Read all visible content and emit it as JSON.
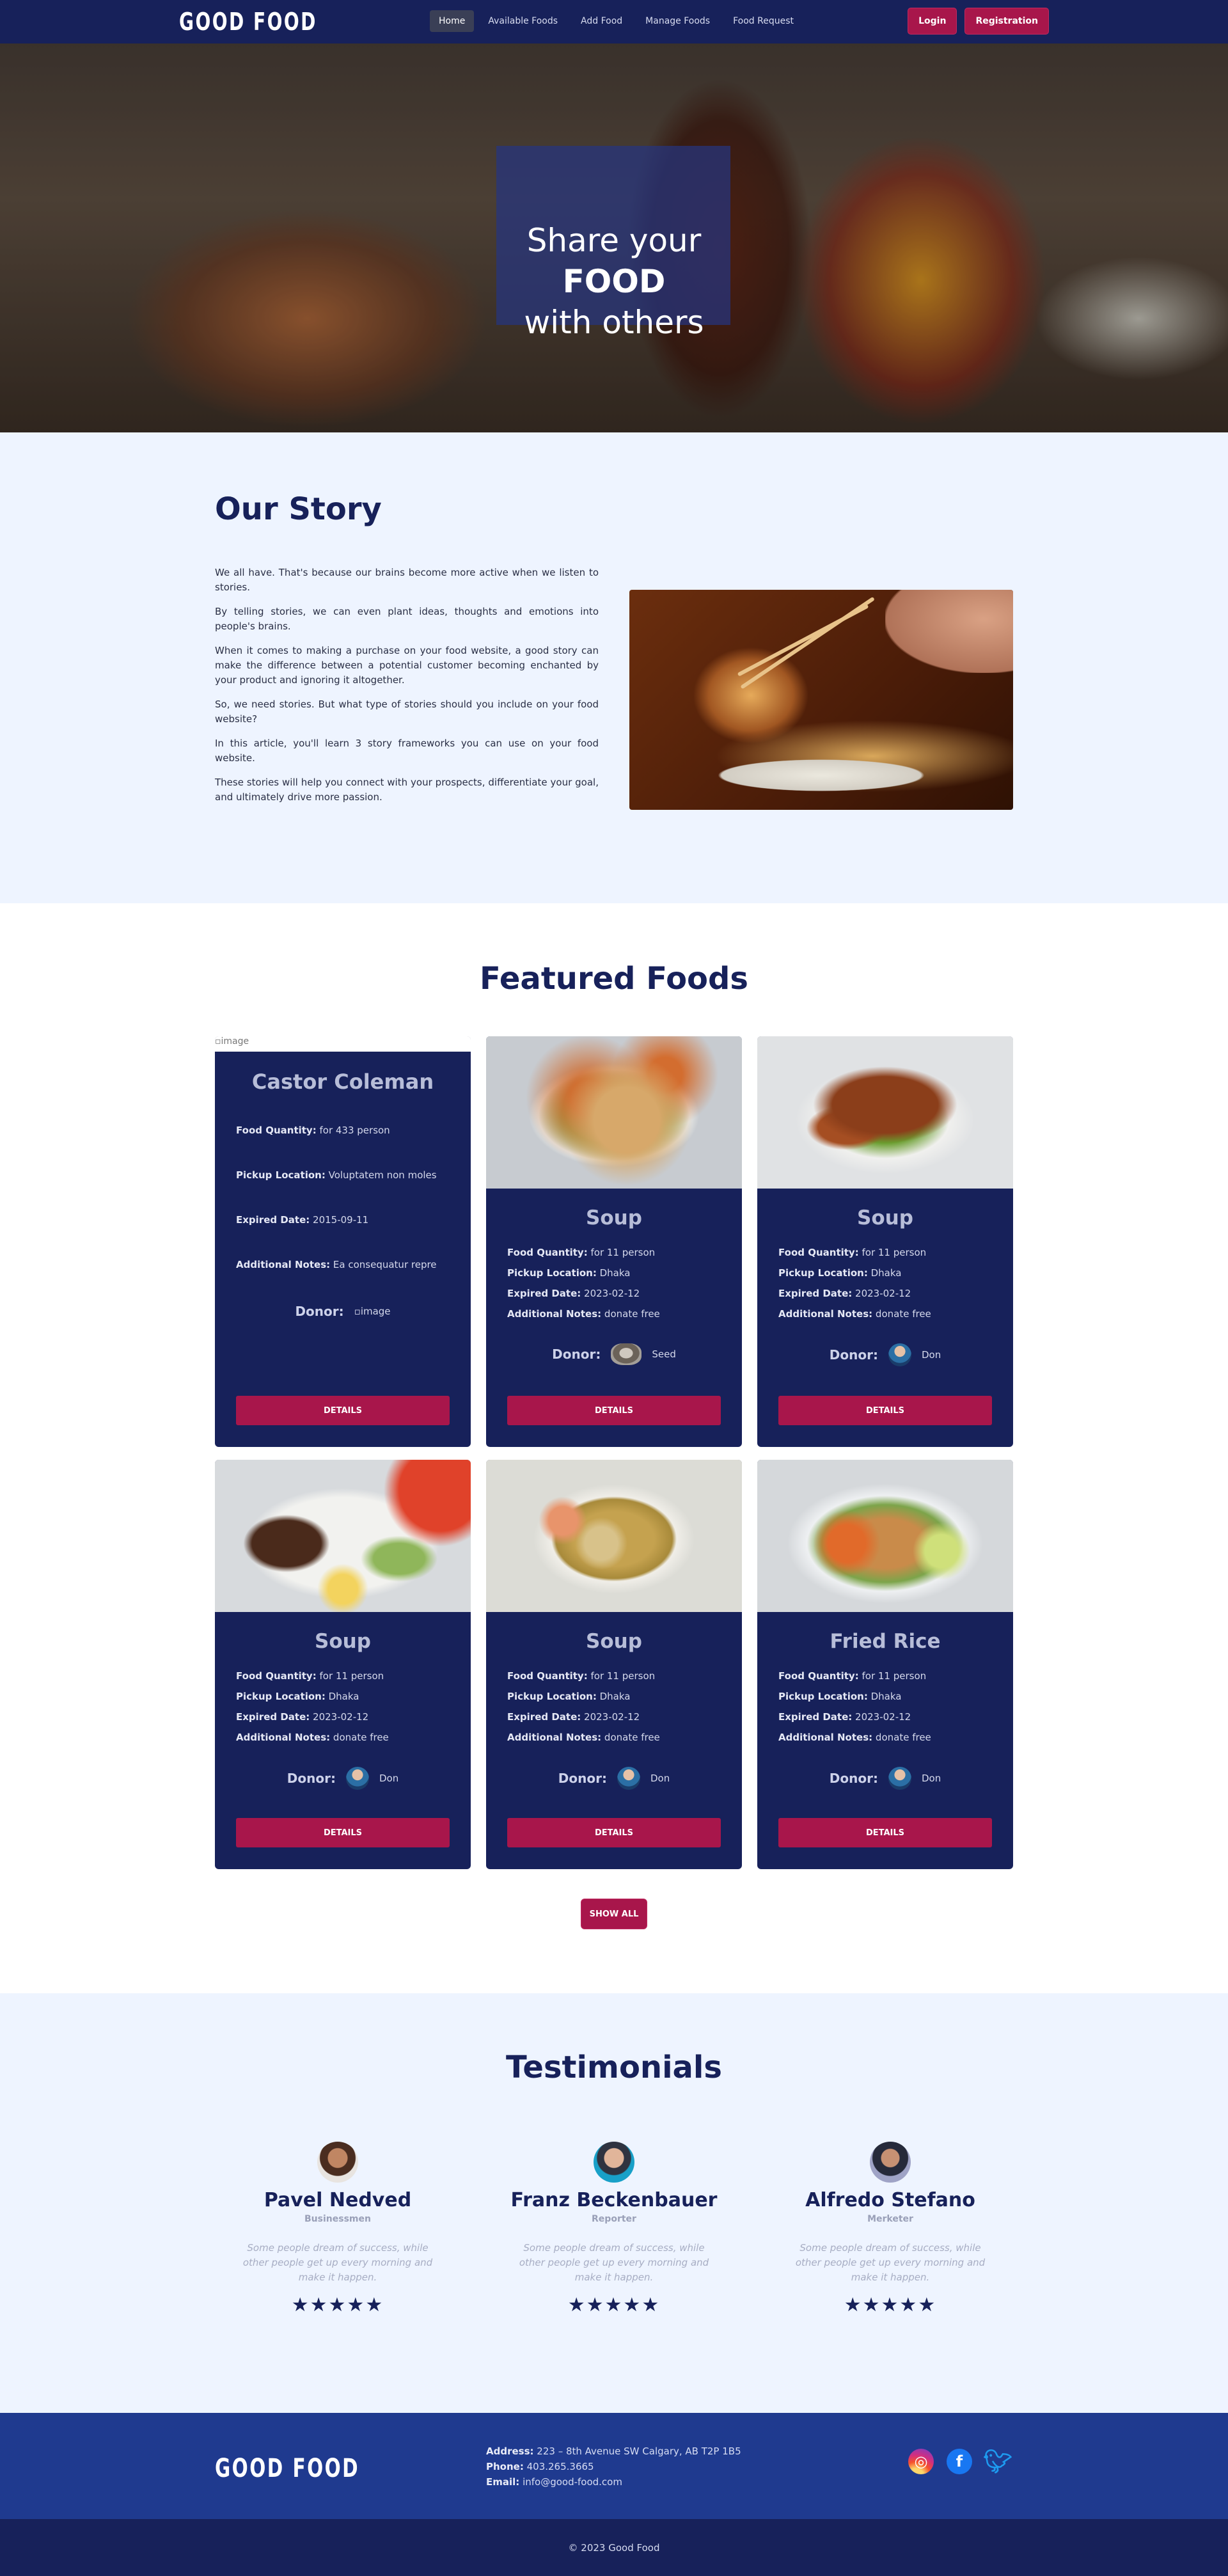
{
  "nav": {
    "logo": "GOOD FOOD",
    "links": [
      "Home",
      "Available Foods",
      "Add Food",
      "Manage Foods",
      "Food Request"
    ],
    "login": "Login",
    "registration": "Registration"
  },
  "hero": {
    "line1": "Share your",
    "line2": "FOOD",
    "line3": "with others"
  },
  "story": {
    "title": "Our Story",
    "paragraphs": [
      "We all have. That's because our brains become more active when we listen to stories.",
      "By telling stories, we can even plant ideas, thoughts and emotions into people's brains.",
      "When it comes to making a purchase on your food website, a good story can make the difference between a potential customer becoming enchanted by your product and ignoring it altogether.",
      "So, we need stories. But what type of stories should you include on your food website?",
      "In this article, you'll learn 3 story frameworks you can use on your food website.",
      "These stories will help you connect with your prospects, differentiate your goal, and ultimately drive more passion."
    ]
  },
  "featured": {
    "title": "Featured Foods",
    "labels": {
      "qty": "Food Quantity:",
      "pickup": "Pickup Location:",
      "expired": "Expired Date:",
      "notes": "Additional Notes:",
      "donor": "Donor:",
      "details": "DETAILS",
      "image_alt": "image"
    },
    "cards": [
      {
        "name": "Castor Coleman",
        "qty": "for 433 person",
        "pickup": "Voluptatem non moles",
        "expired": "2015-09-11",
        "notes": "Ea consequatur repre",
        "donor": ""
      },
      {
        "name": "Soup",
        "qty": "for 11 person",
        "pickup": "Dhaka",
        "expired": "2023-02-12",
        "notes": "donate free",
        "donor": "Seed"
      },
      {
        "name": "Soup",
        "qty": "for 11 person",
        "pickup": "Dhaka",
        "expired": "2023-02-12",
        "notes": "donate free",
        "donor": "Don"
      },
      {
        "name": "Soup",
        "qty": "for 11 person",
        "pickup": "Dhaka",
        "expired": "2023-02-12",
        "notes": "donate free",
        "donor": "Don"
      },
      {
        "name": "Soup",
        "qty": "for 11 person",
        "pickup": "Dhaka",
        "expired": "2023-02-12",
        "notes": "donate free",
        "donor": "Don"
      },
      {
        "name": "Fried Rice",
        "qty": "for 11 person",
        "pickup": "Dhaka",
        "expired": "2023-02-12",
        "notes": "donate free",
        "donor": "Don"
      }
    ],
    "show_all": "SHOW ALL"
  },
  "testimonials": {
    "title": "Testimonials",
    "people": [
      {
        "name": "Pavel Nedved",
        "role": "Businessmen",
        "quote": "Some people dream of success, while other people get up every morning and make it happen.",
        "stars": "★★★★★"
      },
      {
        "name": "Franz Beckenbauer",
        "role": "Reporter",
        "quote": "Some people dream of success, while other people get up every morning and make it happen.",
        "stars": "★★★★★"
      },
      {
        "name": "Alfredo Stefano",
        "role": "Merketer",
        "quote": "Some people dream of success, while other people get up every morning and make it happen.",
        "stars": "★★★★★"
      }
    ]
  },
  "footer": {
    "logo": "GOOD FOOD",
    "address_label": "Address:",
    "address": "223 – 8th Avenue SW Calgary, AB T2P 1B5",
    "phone_label": "Phone:",
    "phone": "403.265.3665",
    "email_label": "Email:",
    "email": "info@good-food.com",
    "social": [
      "instagram-icon",
      "facebook-icon",
      "twitter-icon"
    ],
    "copyright": "© 2023 Good Food"
  },
  "colors": {
    "navy": "#17215a",
    "accent": "#a8164b",
    "light_bg": "#eef4ff",
    "footer_blue": "#1f3a8f"
  }
}
